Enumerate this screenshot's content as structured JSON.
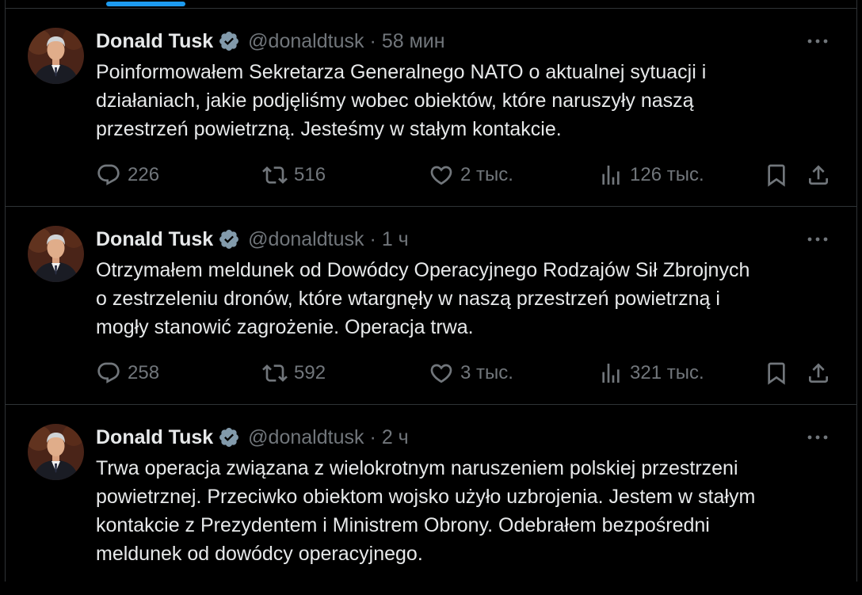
{
  "author": {
    "name": "Donald Tusk",
    "handle": "@donaldtusk",
    "separator": "·"
  },
  "colors": {
    "background": "#000000",
    "text": "#e7e9ea",
    "secondary": "#71767b",
    "divider": "#2f3336",
    "accent": "#1d9bf0"
  },
  "icons": {
    "verified": "verified-badge-icon",
    "more": "more-icon",
    "reply": "reply-icon",
    "retweet": "retweet-icon",
    "like": "heart-icon",
    "views": "views-icon",
    "bookmark": "bookmark-icon",
    "share": "share-icon"
  },
  "tweets": [
    {
      "time": "58 мин",
      "lines": [
        "Poinformowałem Sekretarza Generalnego NATO o aktualnej sytuacji i",
        "działaniach, jakie podjęliśmy wobec obiektów, które naruszyły naszą",
        "przestrzeń powietrzną. Jesteśmy w stałym kontakcie."
      ],
      "replies": "226",
      "retweets": "516",
      "likes": "2 тыс.",
      "views": "126 тыс."
    },
    {
      "time": "1 ч",
      "lines": [
        "Otrzymałem meldunek od Dowódcy Operacyjnego Rodzajów Sił Zbrojnych",
        "o zestrzeleniu dronów, które wtargnęły w naszą przestrzeń powietrzną i",
        "mogły stanowić zagrożenie. Operacja trwa."
      ],
      "replies": "258",
      "retweets": "592",
      "likes": "3 тыс.",
      "views": "321 тыс."
    },
    {
      "time": "2 ч",
      "lines": [
        "Trwa operacja związana z wielokrotnym naruszeniem polskiej przestrzeni",
        "powietrznej. Przeciwko obiektom wojsko użyło uzbrojenia. Jestem w stałym",
        "kontakcie z Prezydentem i Ministrem Obrony. Odebrałem bezpośredni",
        "meldunek od dowódcy operacyjnego."
      ]
    }
  ]
}
